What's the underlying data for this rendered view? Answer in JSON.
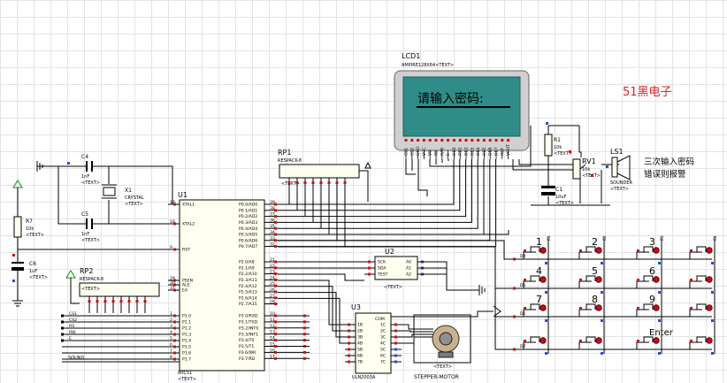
{
  "brand": {
    "text": "51黑电子",
    "color": "#dd2222"
  },
  "lcd": {
    "ref": "LCD1",
    "part": "AMPIRE128X64",
    "text_tag": "<TEXT>",
    "screen_text": "请输入密码:",
    "screen_color": "#2f8c88",
    "pin_labels": [
      "CS1",
      "CS2",
      "GND",
      "VCC",
      "V0",
      "RS",
      "R/W",
      "E",
      "DB0",
      "DB1",
      "DB2",
      "DB3",
      "DB4",
      "DB5",
      "DB6",
      "DB7",
      "RST",
      "VOUT"
    ]
  },
  "note": {
    "line1": "三次输入密码",
    "line2": "错误则报警"
  },
  "mcu": {
    "ref": "U1",
    "part": "80C51",
    "text_tag": "<TEXT>",
    "left_pins": [
      {
        "num": "19",
        "name": "XTAL1"
      },
      {
        "num": "18",
        "name": "XTAL2"
      },
      {
        "num": "9",
        "name": "RST"
      },
      {
        "num": "29",
        "name": "PSEN"
      },
      {
        "num": "30",
        "name": "ALE"
      },
      {
        "num": "31",
        "name": "EA"
      },
      {
        "num": "1",
        "name": "P1.0"
      },
      {
        "num": "2",
        "name": "P1.1"
      },
      {
        "num": "3",
        "name": "P1.2"
      },
      {
        "num": "4",
        "name": "P1.3"
      },
      {
        "num": "5",
        "name": "P1.4"
      },
      {
        "num": "6",
        "name": "P1.5"
      },
      {
        "num": "7",
        "name": "P1.6"
      },
      {
        "num": "8",
        "name": "P1.7"
      }
    ],
    "right_pins": [
      {
        "num": "39",
        "name": "P0.0/AD0"
      },
      {
        "num": "38",
        "name": "P0.1/AD1"
      },
      {
        "num": "37",
        "name": "P0.2/AD2"
      },
      {
        "num": "36",
        "name": "P0.3/AD3"
      },
      {
        "num": "35",
        "name": "P0.4/AD4"
      },
      {
        "num": "34",
        "name": "P0.5/AD5"
      },
      {
        "num": "33",
        "name": "P0.6/AD6"
      },
      {
        "num": "32",
        "name": "P0.7/AD7"
      },
      {
        "num": "21",
        "name": "P2.0/A8"
      },
      {
        "num": "22",
        "name": "P2.1/A9"
      },
      {
        "num": "23",
        "name": "P2.2/A10"
      },
      {
        "num": "24",
        "name": "P2.3/A11"
      },
      {
        "num": "25",
        "name": "P2.4/A12"
      },
      {
        "num": "26",
        "name": "P2.5/A13"
      },
      {
        "num": "27",
        "name": "P2.6/A14"
      },
      {
        "num": "28",
        "name": "P2.7/A15"
      },
      {
        "num": "10",
        "name": "P3.0/RXD"
      },
      {
        "num": "11",
        "name": "P3.1/TXD"
      },
      {
        "num": "12",
        "name": "P3.2/INT0"
      },
      {
        "num": "13",
        "name": "P3.3/INT1"
      },
      {
        "num": "14",
        "name": "P3.4/T0"
      },
      {
        "num": "15",
        "name": "P3.5/T1"
      },
      {
        "num": "16",
        "name": "P3.6/WR"
      },
      {
        "num": "17",
        "name": "P3.7/RD"
      }
    ],
    "p1_net_labels": [
      "CS1",
      "CS2",
      "RS",
      "RW",
      "E"
    ],
    "sound_label": "SOUND"
  },
  "u2": {
    "ref": "U2",
    "text_tag": "<TEXT>",
    "left_pins": [
      "SCK",
      "SDA",
      "TEST"
    ],
    "right_pins": [
      "A0",
      "A1",
      "A2"
    ]
  },
  "u3": {
    "ref": "U3",
    "part": "ULN2003A",
    "text_tag": "<TEXT>",
    "com_label": "COM",
    "in_pins": [
      "1B",
      "2B",
      "3B",
      "4B",
      "5B",
      "6B",
      "7B"
    ],
    "out_pins": [
      "1C",
      "2C",
      "3C",
      "4C",
      "5C",
      "6C",
      "7C"
    ]
  },
  "motor": {
    "label": "STEPPER-MOTOR",
    "text_tag": "<TEXT>"
  },
  "components": {
    "c4": {
      "ref": "C4",
      "value": "1nF",
      "text_tag": "<TEXT>"
    },
    "c5": {
      "ref": "C5",
      "value": "1nF",
      "text_tag": "<TEXT>"
    },
    "c6": {
      "ref": "C6",
      "value": "1uF",
      "text_tag": "<TEXT>"
    },
    "c1": {
      "ref": "C1",
      "value": "10uF",
      "text_tag": "<TEXT>"
    },
    "x1": {
      "ref": "X1",
      "value": "CRYSTAL",
      "text_tag": "<TEXT>"
    },
    "r7": {
      "ref": "R7",
      "value": "10k",
      "text_tag": "<TEXT>"
    },
    "r1": {
      "ref": "R1",
      "value": "10k",
      "text_tag": "<TEXT>"
    },
    "rv1": {
      "ref": "RV1",
      "value": "10k",
      "text_tag": "<TEXT>"
    },
    "ls1": {
      "ref": "LS1",
      "value": "SOUNDER",
      "text_tag": "<TEXT>"
    },
    "rp1": {
      "ref": "RP1",
      "value": "RESPACK-8",
      "text_tag": "<TEXT>"
    },
    "rp2": {
      "ref": "RP2",
      "value": "RESPACK-8",
      "text_tag": "<TEXT>"
    }
  },
  "keypad": {
    "row_labels": [
      "D4",
      "D5",
      "D6",
      "D7"
    ],
    "column_labels": [
      "E1",
      "E2",
      "E3",
      "E4"
    ],
    "keys": [
      [
        "1",
        "2",
        "3",
        ""
      ],
      [
        "4",
        "5",
        "6",
        ""
      ],
      [
        "7",
        "8",
        "9",
        ""
      ],
      [
        "",
        "",
        "Enter",
        ""
      ]
    ]
  },
  "colors": {
    "wire": "#000000",
    "pin_marker_red": "#cc1111",
    "pin_marker_blue": "#2c4ad8",
    "ground_green": "#1a8a1a",
    "component_fill": "#fffff0",
    "grid": "#e3e3e3"
  }
}
